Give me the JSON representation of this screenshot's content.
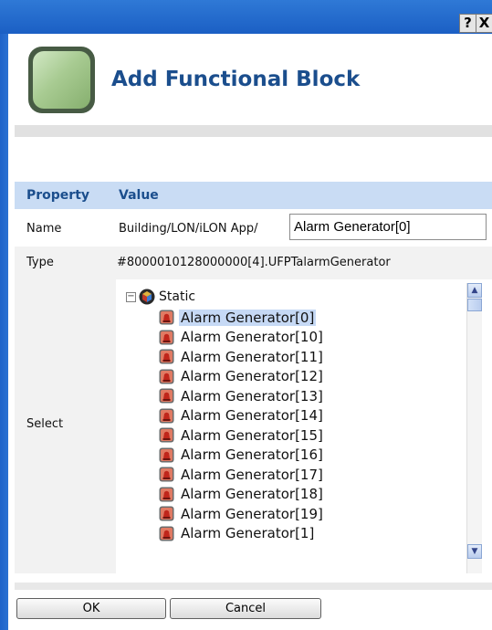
{
  "titlebar": {
    "help_glyph": "?",
    "close_glyph": "X"
  },
  "header": {
    "title": "Add Functional Block",
    "icon": "functional-block-icon",
    "accent": "#1b4e8d"
  },
  "table": {
    "col_property": "Property",
    "col_value": "Value",
    "header_bg": "#c9dcf4",
    "name": {
      "label": "Name",
      "path_prefix": "Building/LON/iLON App/",
      "input_value": "Alarm Generator[0]"
    },
    "type": {
      "label": "Type",
      "value": "#8000010128000000[4].UFPTalarmGenerator"
    },
    "select": {
      "label": "Select",
      "root_label": "Static",
      "root_icon": "cube-icon",
      "item_icon": "alarm-generator-icon",
      "selected_index": 0,
      "items": [
        "Alarm Generator[0]",
        "Alarm Generator[10]",
        "Alarm Generator[11]",
        "Alarm Generator[12]",
        "Alarm Generator[13]",
        "Alarm Generator[14]",
        "Alarm Generator[15]",
        "Alarm Generator[16]",
        "Alarm Generator[17]",
        "Alarm Generator[18]",
        "Alarm Generator[19]",
        "Alarm Generator[1]"
      ]
    }
  },
  "footer": {
    "ok_label": "OK",
    "cancel_label": "Cancel"
  }
}
